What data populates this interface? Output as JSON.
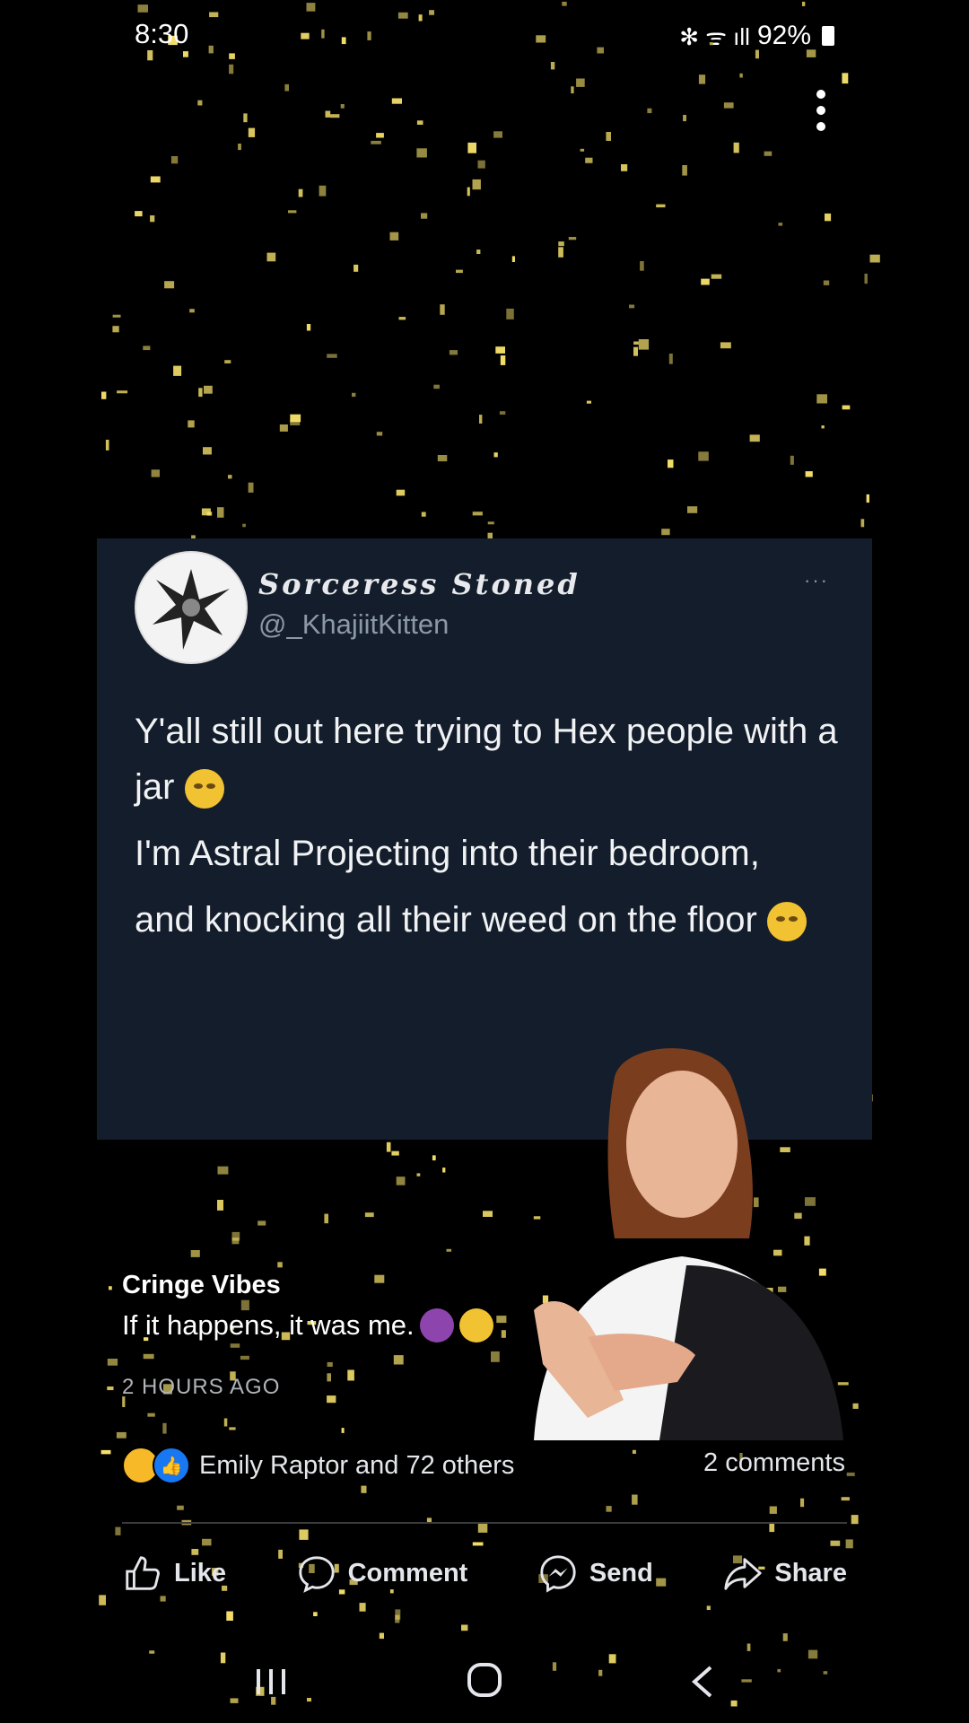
{
  "status": {
    "time": "8:30",
    "icons": "✻ ᯤ ıll",
    "battery": "92%"
  },
  "tweet": {
    "display_name": "Sorceress Stoned",
    "handle": "@_KhajiitKitten",
    "more": "···",
    "line1": "Y'all still out here trying to Hex people with a jar",
    "line2": "I'm Astral Projecting into their bedroom,",
    "line3": "and knocking all their weed on the floor"
  },
  "post": {
    "author": "Cringe Vibes",
    "caption": "If it happens, it was me.",
    "time": "2 HOURS AGO",
    "reactions_text": "Emily Raptor and 72 others",
    "comments_count": "2 comments"
  },
  "actions": {
    "like": "Like",
    "comment": "Comment",
    "send": "Send",
    "share": "Share"
  },
  "icons": [
    "more-vert-icon",
    "like-icon",
    "comment-icon",
    "messenger-icon",
    "share-icon",
    "recents-icon",
    "home-icon",
    "back-icon"
  ],
  "colors": {
    "background": "#000000",
    "card": "#141d2b",
    "sparkle": "#f5e06b",
    "like_blue": "#1877f2",
    "haha_yellow": "#f7b928"
  }
}
